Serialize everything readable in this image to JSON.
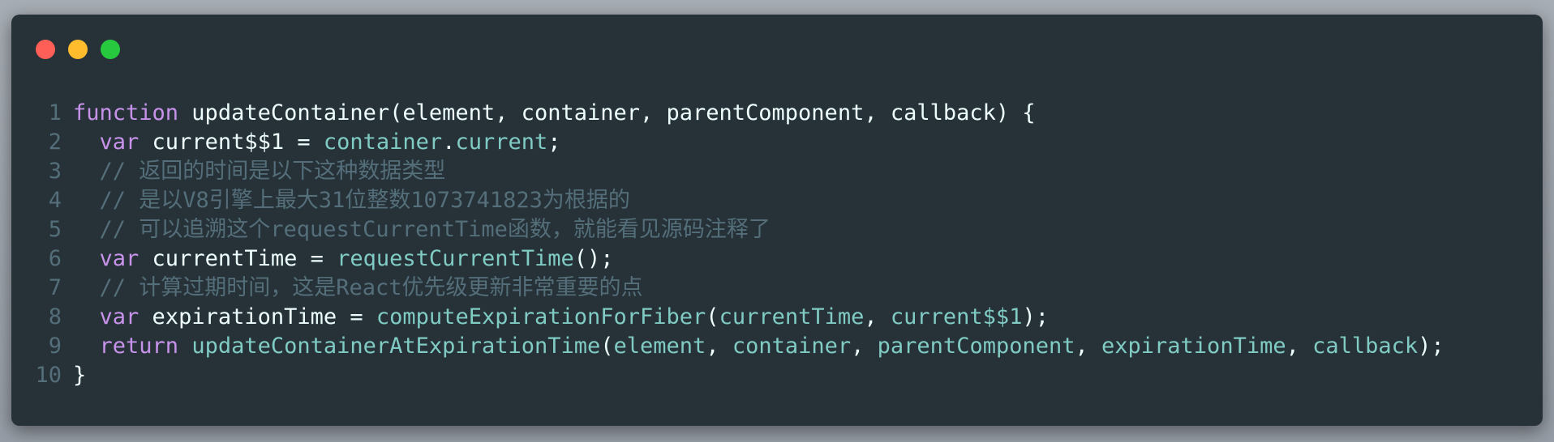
{
  "window": {
    "buttons": {
      "close_color": "#ff5f56",
      "minimize_color": "#ffbd2e",
      "maximize_color": "#27c93f"
    }
  },
  "code": {
    "line_numbers": [
      "1",
      "2",
      "3",
      "4",
      "5",
      "6",
      "7",
      "8",
      "9",
      "10"
    ],
    "lines": [
      [
        {
          "t": "function",
          "c": "kw"
        },
        {
          "t": " updateContainer(element, container, parentComponent, callback) {",
          "c": "pl"
        }
      ],
      [
        {
          "t": "  ",
          "c": "pl"
        },
        {
          "t": "var",
          "c": "kw"
        },
        {
          "t": " current$$1 = ",
          "c": "pl"
        },
        {
          "t": "container",
          "c": "prop"
        },
        {
          "t": ".",
          "c": "pl"
        },
        {
          "t": "current",
          "c": "prop"
        },
        {
          "t": ";",
          "c": "pl"
        }
      ],
      [
        {
          "t": "  // 返回的时间是以下这种数据类型",
          "c": "cm"
        }
      ],
      [
        {
          "t": "  // 是以V8引擎上最大31位整数1073741823为根据的",
          "c": "cm"
        }
      ],
      [
        {
          "t": "  // 可以追溯这个requestCurrentTime函数，就能看见源码注释了",
          "c": "cm"
        }
      ],
      [
        {
          "t": "  ",
          "c": "pl"
        },
        {
          "t": "var",
          "c": "kw"
        },
        {
          "t": " currentTime = ",
          "c": "pl"
        },
        {
          "t": "requestCurrentTime",
          "c": "prop"
        },
        {
          "t": "();",
          "c": "pl"
        }
      ],
      [
        {
          "t": "  // 计算过期时间，这是React优先级更新非常重要的点",
          "c": "cm"
        }
      ],
      [
        {
          "t": "  ",
          "c": "pl"
        },
        {
          "t": "var",
          "c": "kw"
        },
        {
          "t": " expirationTime = ",
          "c": "pl"
        },
        {
          "t": "computeExpirationForFiber",
          "c": "prop"
        },
        {
          "t": "(",
          "c": "pl"
        },
        {
          "t": "currentTime",
          "c": "prop"
        },
        {
          "t": ", ",
          "c": "pl"
        },
        {
          "t": "current$$1",
          "c": "prop"
        },
        {
          "t": ");",
          "c": "pl"
        }
      ],
      [
        {
          "t": "  ",
          "c": "pl"
        },
        {
          "t": "return",
          "c": "kw"
        },
        {
          "t": " ",
          "c": "pl"
        },
        {
          "t": "updateContainerAtExpirationTime",
          "c": "prop"
        },
        {
          "t": "(",
          "c": "pl"
        },
        {
          "t": "element",
          "c": "prop"
        },
        {
          "t": ", ",
          "c": "pl"
        },
        {
          "t": "container",
          "c": "prop"
        },
        {
          "t": ", ",
          "c": "pl"
        },
        {
          "t": "parentComponent",
          "c": "prop"
        },
        {
          "t": ", ",
          "c": "pl"
        },
        {
          "t": "expirationTime",
          "c": "prop"
        },
        {
          "t": ", ",
          "c": "pl"
        },
        {
          "t": "callback",
          "c": "prop"
        },
        {
          "t": ");",
          "c": "pl"
        }
      ],
      [
        {
          "t": "}",
          "c": "pl"
        }
      ]
    ]
  }
}
